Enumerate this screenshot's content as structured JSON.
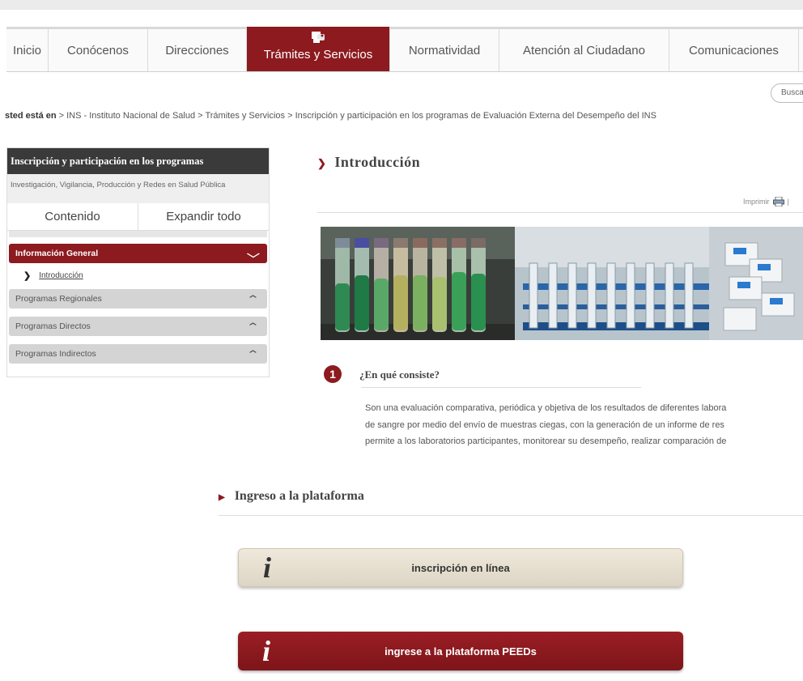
{
  "nav": {
    "items": [
      {
        "label": "Inicio"
      },
      {
        "label": "Conócenos"
      },
      {
        "label": "Direcciones"
      },
      {
        "label": "Trámites y Servicios"
      },
      {
        "label": "Normatividad"
      },
      {
        "label": "Atención al Ciudadano"
      },
      {
        "label": "Comunicaciones"
      }
    ]
  },
  "search": {
    "label": "Busca"
  },
  "breadcrumb": {
    "lead": "sted está en",
    "path": " > INS - Instituto Nacional de Salud > Trámites y Servicios > Inscripción y participación en los programas de Evaluación Externa del Desempeño del INS"
  },
  "sidebar": {
    "title": "Inscripción y participación en los programas",
    "subtitle": "Investigación, Vigilancia, Producción y Redes en Salud Pública",
    "tabs": [
      "Contenido",
      "Expandir todo"
    ],
    "sections": [
      {
        "label": "Información General",
        "links": [
          "Introducción"
        ]
      },
      {
        "label": "Programas Regionales"
      },
      {
        "label": "Programas Directos"
      },
      {
        "label": "Programas Indirectos"
      }
    ]
  },
  "main": {
    "title": "Introducción",
    "print_label": "Imprimir",
    "question_number": "1",
    "question_title": "¿En qué consiste?",
    "paragraph": [
      "Son una evaluación comparativa, periódica y objetiva de los resultados de diferentes labora",
      "de sangre por medio del envío de muestras ciegas, con la generación de un informe de res",
      "permite a los laboratorios participantes, monitorear su desempeño, realizar comparación de"
    ]
  },
  "ingreso": {
    "title": "Ingreso a la plataforma",
    "btn_inscripcion": "inscripción en línea",
    "btn_ingrese": "ingrese a la plataforma PEEDs",
    "info_glyph": "i"
  }
}
